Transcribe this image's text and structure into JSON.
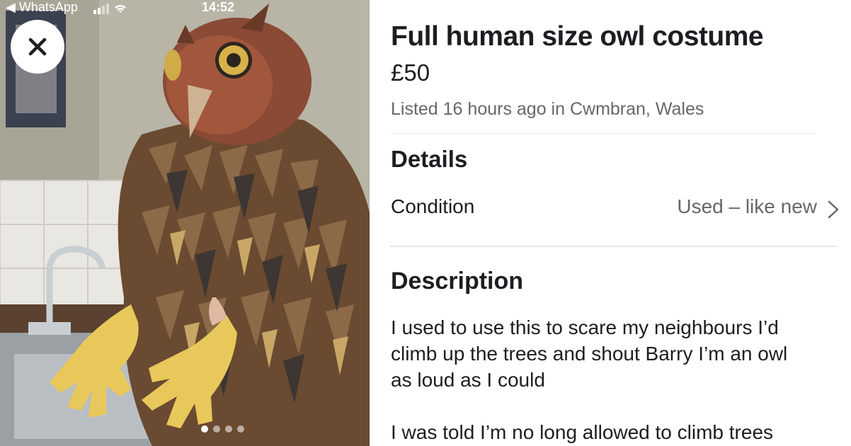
{
  "status_bar": {
    "back_app": "◀ WhatsApp",
    "time": "14:52"
  },
  "photo": {
    "description_icon": "photo",
    "dots_total": 4,
    "dots_active": 1
  },
  "listing": {
    "title": "Full human size owl costume",
    "price": "£50",
    "listed": "Listed 16 hours ago in Cwmbran, Wales"
  },
  "details": {
    "heading": "Details",
    "condition_label": "Condition",
    "condition_value": "Used – like new"
  },
  "description": {
    "heading": "Description",
    "text": "I used to use this to scare my neighbours I’d\nclimb up the trees and shout Barry I’m an owl\nas loud as I could\n\nI was told I’m no long allowed to climb trees"
  },
  "colors": {
    "text_primary": "#1c1e21",
    "text_secondary": "#65676b",
    "divider": "#e4e6eb"
  }
}
